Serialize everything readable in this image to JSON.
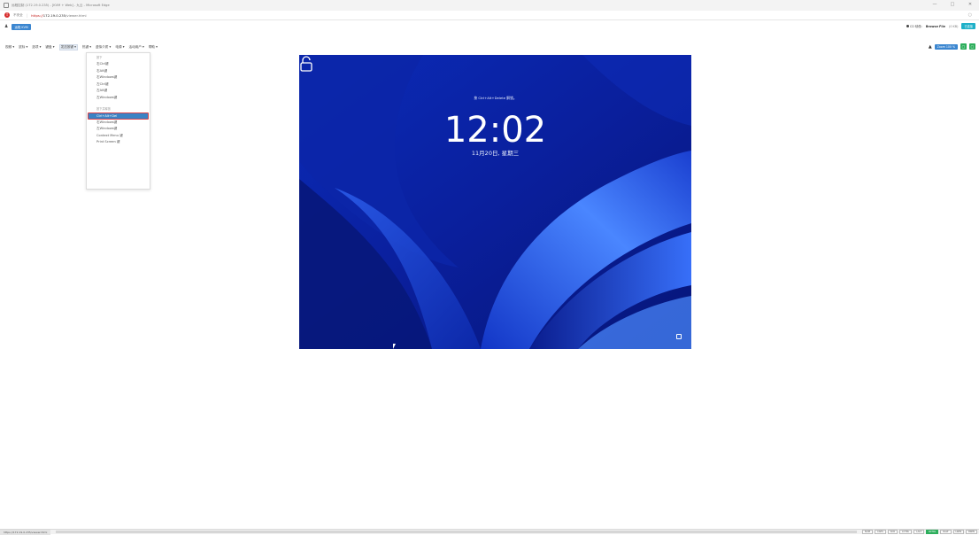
{
  "window": {
    "title": "远程控制 (172.19.0.235) - [KVM + Web] - 九云 - Microsoft Edge",
    "controls": [
      "—",
      "□",
      "✕"
    ]
  },
  "address": {
    "security_label": "不安全",
    "https": "https://",
    "host": "172.19.0.235",
    "path": "/viewer.html"
  },
  "kvm": {
    "chip": "远程 KVM",
    "cd_status": "CD 映像:",
    "browse": "Browse File",
    "cd_count": "(0 KB)",
    "action_button": "已连接"
  },
  "menubar": {
    "items": [
      "视频 ▾",
      "鼠标 ▾",
      "选项 ▾",
      "键盘 ▾",
      "发送按键 ▾",
      "热键 ▾",
      "虚拟介质 ▾",
      "电源 ▾",
      "活动用户 ▾",
      "帮助 ▾"
    ],
    "active_index": 4,
    "zoom": "Zoom 100 %"
  },
  "dropdown": {
    "hold_header": "按下",
    "hold_items": [
      "右Ctrl键",
      "右Alt键",
      "右Windows键",
      "左Ctrl键",
      "左Alt键",
      "左Windows键"
    ],
    "press_header": "按下并释放",
    "selected_item": "Ctrl+Alt+Del",
    "press_items": [
      "右Windows键",
      "左Windows键",
      "Context Menu 键",
      "Print Screen 键"
    ]
  },
  "screen": {
    "hint": "按 Ctrl+Alt+Delete 解锁。",
    "time": "12:02",
    "date": "11月20日, 星期三"
  },
  "statusbar": {
    "url": "https://172.19.0.235/viewer.html",
    "keys": [
      "NUM",
      "CAPS",
      "SCR",
      "LCTRL",
      "LALT",
      "RCTRL",
      "RALT",
      "LWIN",
      "RWIN"
    ],
    "active_key": "RCTRL"
  },
  "colors": {
    "accent": "#3b86d0",
    "selected_border": "#d9434a",
    "wallpaper": "#0a22a8"
  }
}
